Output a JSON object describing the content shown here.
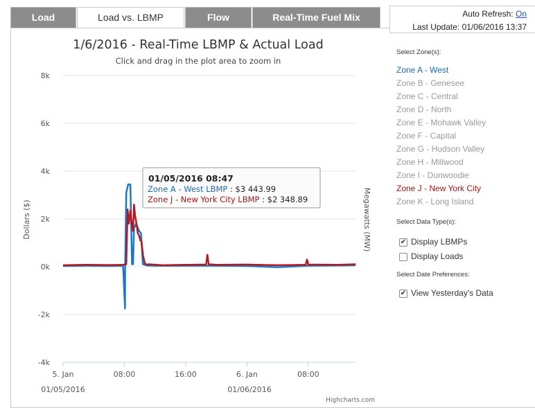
{
  "tabs": [
    {
      "label": "Load",
      "active": false
    },
    {
      "label": "Load vs. LBMP",
      "active": true
    },
    {
      "label": "Flow",
      "active": false
    },
    {
      "label": "Real-Time Fuel Mix",
      "active": false
    }
  ],
  "refresh": {
    "auto_refresh_label": "Auto Refresh:",
    "auto_refresh_value": "On",
    "last_update_label": "Last Update:",
    "last_update_value": "01/06/2016 13:37"
  },
  "sidebar": {
    "zones_header": "Select Zone(s):",
    "zones": [
      "Zone A - West",
      "Zone B - Genesee",
      "Zone C - Central",
      "Zone D - North",
      "Zone E - Mohawk Valley",
      "Zone F - Capital",
      "Zone G - Hudson Valley",
      "Zone H - Millwood",
      "Zone I - Dunwoodie",
      "Zone J - New York City",
      "Zone K - Long Island"
    ],
    "data_type_header": "Select Data Type(s):",
    "display_lbmps": "Display LBMPs",
    "display_lbmps_checked": true,
    "display_loads": "Display Loads",
    "display_loads_checked": false,
    "date_pref_header": "Select Date Preferences:",
    "view_yesterday": "View Yesterday's Data",
    "view_yesterday_checked": true
  },
  "chart_data": {
    "type": "line",
    "title": "1/6/2016 - Real-Time LBMP & Actual Load",
    "subtitle": "Click and drag in the plot area to zoom in",
    "ylabel": "Dollars ($)",
    "ylabel_right": "Megawatts (MW)",
    "ylim": [
      -4000,
      8000
    ],
    "y_ticks": [
      "-4k",
      "-2k",
      "0k",
      "2k",
      "4k",
      "6k",
      "8k"
    ],
    "x_ticks": [
      "5. Jan",
      "08:00",
      "16:00",
      "6. Jan",
      "08:00"
    ],
    "x_dates": [
      "01/05/2016",
      "01/06/2016"
    ],
    "xlim": [
      "2016-01-05 00:00",
      "2016-01-06 14:10"
    ],
    "credits": "Highcharts.com",
    "series": [
      {
        "name": "Zone A - West LBMP",
        "color": "#1a77c9",
        "x": [
          "2016-01-05 00:00",
          "2016-01-05 03:00",
          "2016-01-05 06:00",
          "2016-01-05 07:50",
          "2016-01-05 08:05",
          "2016-01-05 08:06",
          "2016-01-05 08:15",
          "2016-01-05 08:30",
          "2016-01-05 08:40",
          "2016-01-05 08:47",
          "2016-01-05 09:00",
          "2016-01-05 09:08",
          "2016-01-05 09:15",
          "2016-01-05 09:20",
          "2016-01-05 09:30",
          "2016-01-05 09:40",
          "2016-01-05 09:55",
          "2016-01-05 10:10",
          "2016-01-05 10:25",
          "2016-01-05 10:40",
          "2016-01-05 10:50",
          "2016-01-05 11:00",
          "2016-01-05 12:00",
          "2016-01-05 16:00",
          "2016-01-05 20:00",
          "2016-01-06 00:00",
          "2016-01-06 04:00",
          "2016-01-06 08:00",
          "2016-01-06 12:00",
          "2016-01-06 14:10"
        ],
        "y": [
          30,
          40,
          30,
          40,
          -1750,
          40,
          3100,
          3443.99,
          3443.99,
          3443.99,
          100,
          100,
          1600,
          1650,
          1800,
          1700,
          1500,
          1400,
          100,
          80,
          60,
          50,
          40,
          40,
          40,
          30,
          -20,
          40,
          50,
          60
        ]
      },
      {
        "name": "Zone J - New York City LBMP",
        "color": "#b5181e",
        "x": [
          "2016-01-05 00:00",
          "2016-01-05 03:00",
          "2016-01-05 06:00",
          "2016-01-05 07:50",
          "2016-01-05 08:15",
          "2016-01-05 08:25",
          "2016-01-05 08:35",
          "2016-01-05 08:47",
          "2016-01-05 09:00",
          "2016-01-05 09:08",
          "2016-01-05 09:15",
          "2016-01-05 09:25",
          "2016-01-05 09:35",
          "2016-01-05 09:45",
          "2016-01-05 09:55",
          "2016-01-05 10:05",
          "2016-01-05 10:15",
          "2016-01-05 10:25",
          "2016-01-05 10:40",
          "2016-01-05 10:55",
          "2016-01-05 11:10",
          "2016-01-05 13:00",
          "2016-01-05 16:00",
          "2016-01-05 18:40",
          "2016-01-05 18:50",
          "2016-01-05 19:00",
          "2016-01-05 20:00",
          "2016-01-06 00:00",
          "2016-01-06 04:00",
          "2016-01-06 07:40",
          "2016-01-06 07:50",
          "2016-01-06 08:00",
          "2016-01-06 12:00",
          "2016-01-06 14:10"
        ],
        "y": [
          60,
          80,
          70,
          80,
          100,
          2400,
          1800,
          2348.89,
          1700,
          1500,
          2600,
          2100,
          1800,
          1400,
          1300,
          1100,
          1050,
          500,
          150,
          80,
          100,
          60,
          80,
          90,
          500,
          100,
          80,
          90,
          60,
          80,
          300,
          90,
          80,
          100
        ]
      }
    ],
    "tooltip": {
      "title": "01/05/2016 08:47",
      "lines": [
        {
          "series": "Zone A - West LBMP",
          "value": "$3 443.99"
        },
        {
          "series": "Zone J - New York City LBMP",
          "value": "$2 348.89"
        }
      ]
    }
  }
}
